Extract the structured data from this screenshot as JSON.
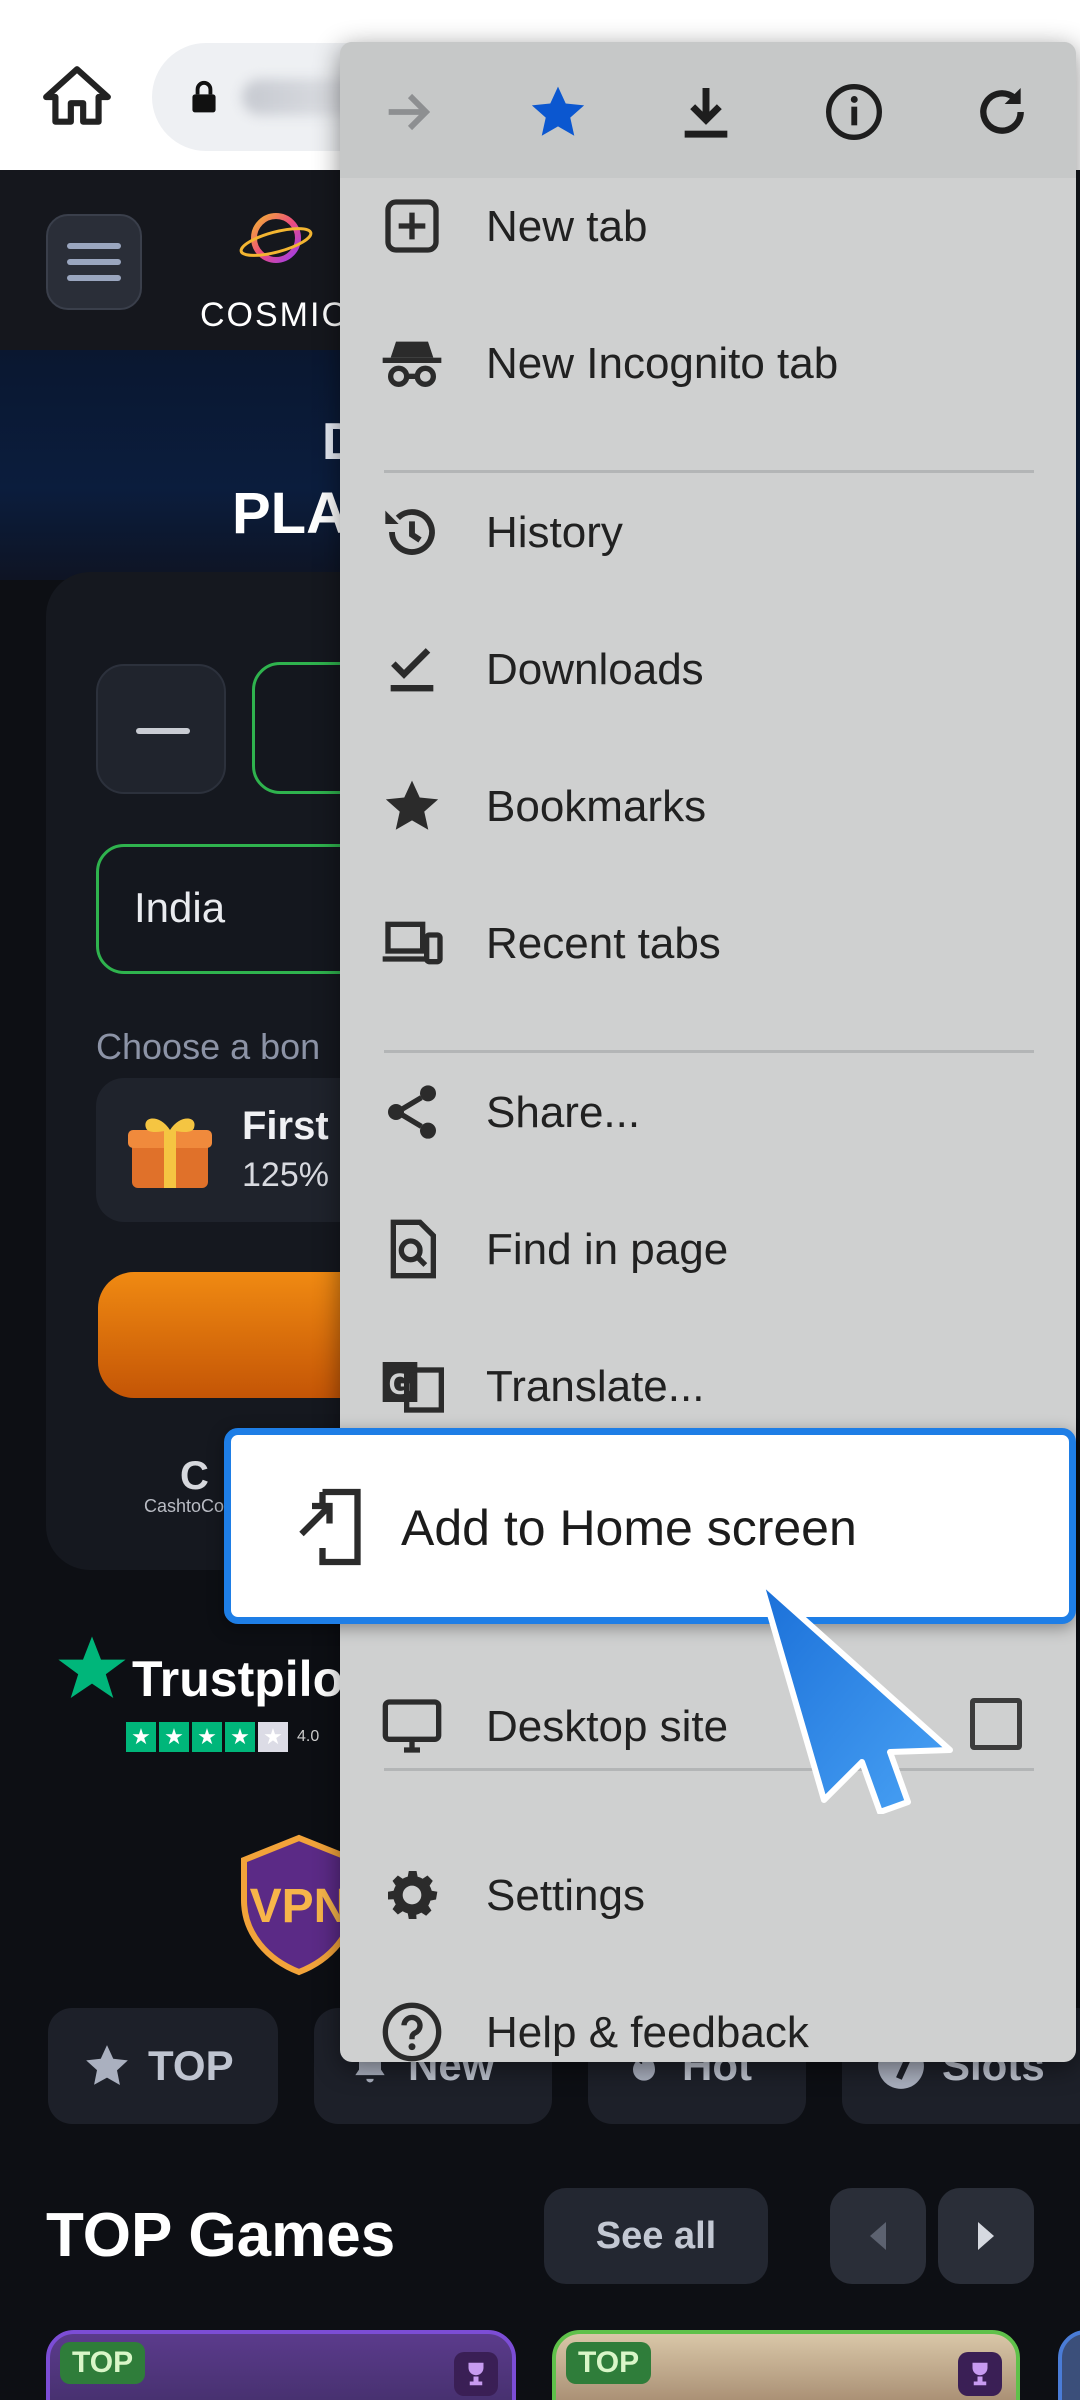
{
  "site": {
    "logo_text": "COSMIC",
    "hero_line1": "D",
    "hero_line2": "PLA",
    "country_value": "India",
    "bonus_label": "Choose a bon",
    "bonus_title": "First",
    "bonus_subtitle": "125%",
    "cash_logo_mark": "C",
    "cash_logo_text": "CashtoCo",
    "trustpilot_text": "Trustpilot",
    "trustpilot_score": "4.0",
    "vpn_text": "VPN",
    "chips": [
      {
        "label": "TOP"
      },
      {
        "label": "New"
      },
      {
        "label": "Hot"
      },
      {
        "label": "Slots"
      }
    ],
    "top_games_title": "TOP Games",
    "see_all_label": "See all",
    "game_tags": [
      "TOP",
      "TOP"
    ]
  },
  "menu": {
    "items": [
      {
        "label": "New tab",
        "icon": "plus-box-icon"
      },
      {
        "label": "New Incognito tab",
        "icon": "incognito-icon"
      },
      {
        "label": "History",
        "icon": "history-icon"
      },
      {
        "label": "Downloads",
        "icon": "download-check-icon"
      },
      {
        "label": "Bookmarks",
        "icon": "star-icon"
      },
      {
        "label": "Recent tabs",
        "icon": "devices-icon"
      },
      {
        "label": "Share...",
        "icon": "share-icon"
      },
      {
        "label": "Find in page",
        "icon": "find-in-page-icon"
      },
      {
        "label": "Translate...",
        "icon": "translate-icon"
      },
      {
        "label": "Desktop site",
        "icon": "monitor-icon"
      },
      {
        "label": "Settings",
        "icon": "gear-icon"
      },
      {
        "label": "Help & feedback",
        "icon": "help-icon"
      }
    ],
    "highlight_label": "Add to Home screen",
    "desktop_site_checked": false
  },
  "colors": {
    "accent_blue": "#1e7ee6",
    "bookmark_star": "#0b57d0",
    "green_border": "#2fb34e",
    "cta_orange": "#f08a12"
  }
}
